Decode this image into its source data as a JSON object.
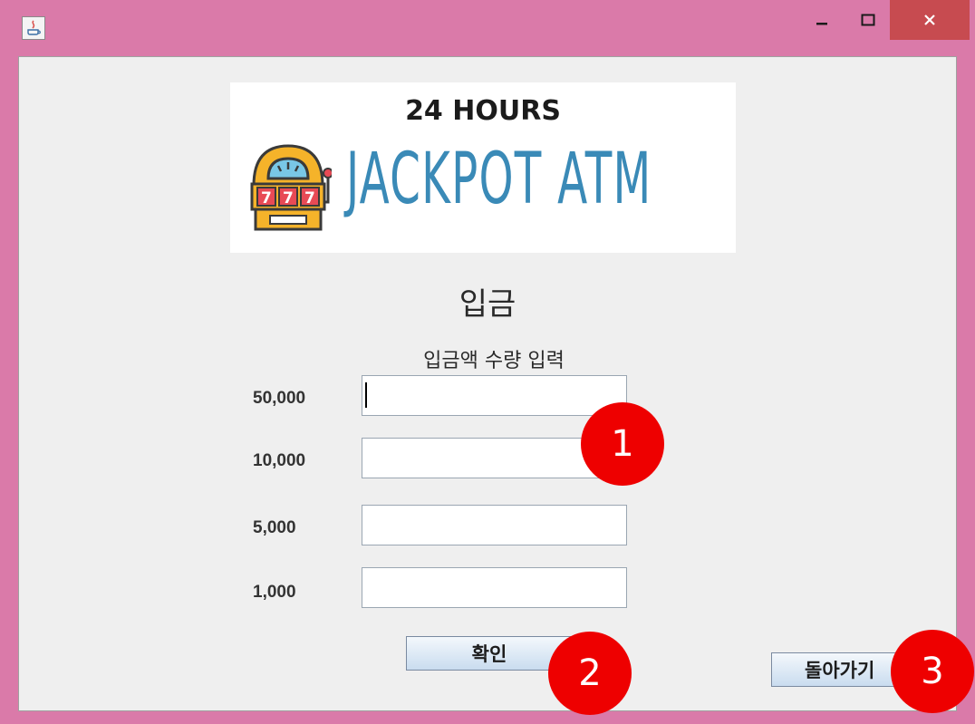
{
  "window": {
    "close_glyph": "×",
    "minimize_glyph": "–",
    "maximize_glyph": "☐"
  },
  "logo": {
    "top_text": "24 HOURS",
    "main_text": "JACKPOT ATM",
    "slot_digits": "777",
    "accent_color": "#3a8ab7"
  },
  "page": {
    "title": "입금",
    "subtitle": "입금액 수량 입력"
  },
  "denominations": [
    {
      "label": "50,000",
      "value": ""
    },
    {
      "label": "10,000",
      "value": ""
    },
    {
      "label": "5,000",
      "value": ""
    },
    {
      "label": "1,000",
      "value": ""
    }
  ],
  "buttons": {
    "confirm_label": "확인",
    "back_label": "돌아가기"
  },
  "markers": [
    "1",
    "2",
    "3"
  ],
  "colors": {
    "title_bar": "#da7aa9",
    "close_button": "#c74b50",
    "marker": "#ee0000"
  }
}
